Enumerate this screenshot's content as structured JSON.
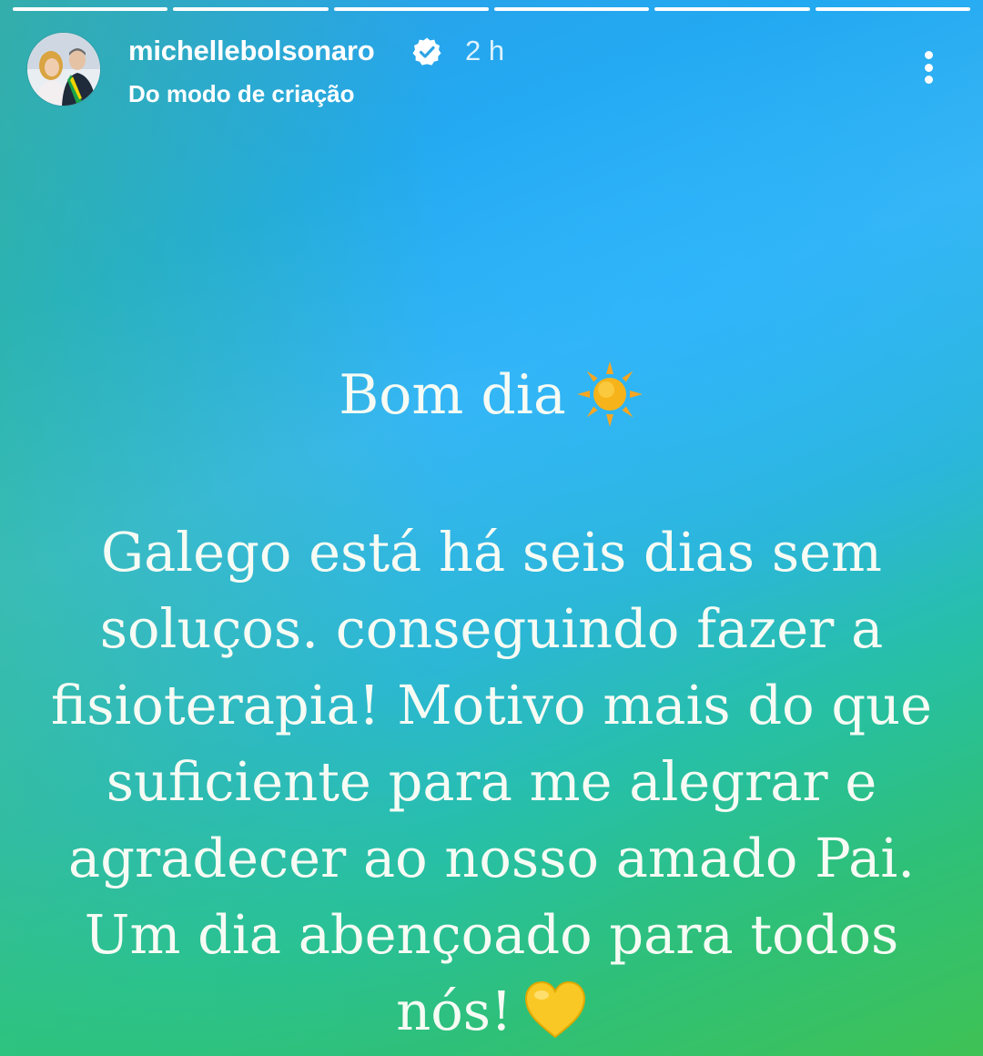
{
  "story": {
    "progress_segments": [
      1,
      1,
      1,
      1,
      1,
      1
    ],
    "header": {
      "username": "michellebolsonaro",
      "verified": true,
      "time": "2 h",
      "subtitle": "Do modo de criação",
      "icons": {
        "verified": "verified-badge-icon",
        "more": "more-vertical-icon"
      }
    },
    "content": {
      "greeting": "Bom dia",
      "greeting_icon": "sun-emoji-icon",
      "message": "Galego está há seis dias sem soluços. conseguindo fazer a fisioterapia! Motivo mais do que suficiente para me alegrar e agradecer ao nosso amado Pai. Um dia abençoado para todos nós!",
      "message_icon": "yellow-heart-emoji-icon"
    },
    "colors": {
      "background_top": "#2f9fe6",
      "background_middle": "#38b6f5",
      "background_bottom": "#3fc255",
      "text": "#f6fbf4",
      "heart": "#f9c824",
      "sun": "#f7b31a"
    }
  }
}
